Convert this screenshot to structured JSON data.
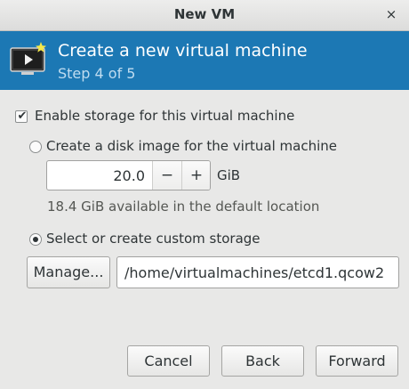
{
  "window": {
    "title": "New VM",
    "close_icon": "close-icon",
    "close_glyph": "×"
  },
  "header": {
    "icon": "virtual-machine-icon",
    "title": "Create a new virtual machine",
    "step": "Step 4 of 5",
    "background_color": "#1c78b4"
  },
  "storage": {
    "enable_label": "Enable storage for this virtual machine",
    "enable_checked": true,
    "create_disk_label": "Create a disk image for the virtual machine",
    "create_disk_selected": false,
    "disk_size_value": "20.0",
    "decrement_glyph": "−",
    "increment_glyph": "+",
    "size_unit": "GiB",
    "available_text": "18.4 GiB available in the default location",
    "custom_label": "Select or create custom storage",
    "custom_selected": true,
    "manage_label": "Manage...",
    "path_value": "/home/virtualmachines/etcd1.qcow2"
  },
  "buttons": {
    "cancel": "Cancel",
    "back": "Back",
    "forward": "Forward"
  }
}
